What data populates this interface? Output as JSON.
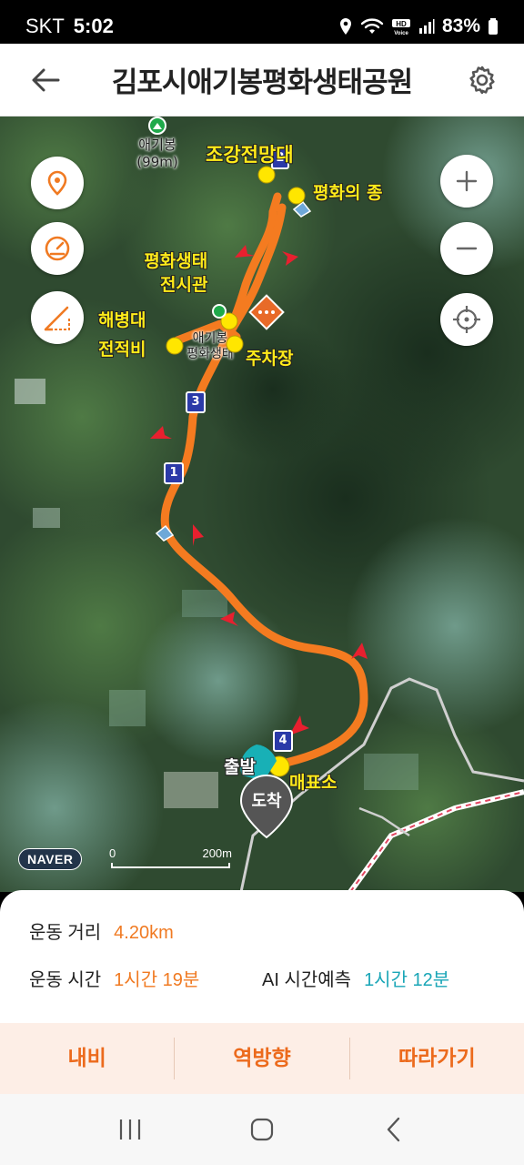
{
  "status_bar": {
    "carrier": "SKT",
    "time": "5:02",
    "battery": "83%"
  },
  "header": {
    "title": "김포시애기봉평화생태공원"
  },
  "map": {
    "peak": {
      "name": "애기봉",
      "elevation": "(99m)"
    },
    "labels": {
      "observatory": "조강전망대",
      "bell": "평화의 종",
      "exhibition_line1": "평화생태",
      "exhibition_line2": "전시관",
      "memorial_line1": "해병대",
      "memorial_line2": "전적비",
      "parking": "주차장",
      "ticket": "매표소",
      "start": "출발",
      "arrive": "도착",
      "poi_behind_line1": "애기봉",
      "poi_behind_line2": "평화생태"
    },
    "markers": [
      "1",
      "2",
      "3",
      "4"
    ],
    "provider": "NAVER",
    "scale": {
      "zero": "0",
      "distance": "200m"
    },
    "colors": {
      "route": "#f47b20",
      "arrow": "#e8202f",
      "poi": "#ffe600"
    }
  },
  "stats": {
    "distance_label": "운동 거리",
    "distance_value": "4.20km",
    "time_label": "운동 시간",
    "time_value": "1시간 19분",
    "ai_label": "AI 시간예측",
    "ai_value": "1시간 12분"
  },
  "actions": {
    "navi": "내비",
    "reverse": "역방향",
    "follow": "따라가기"
  }
}
